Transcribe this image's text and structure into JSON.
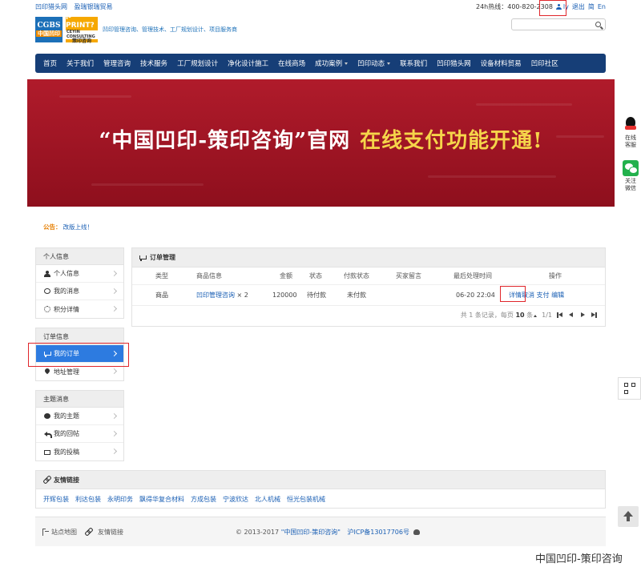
{
  "topbar": {
    "links": [
      "凹印猎头网",
      "盈瑞银瑞贸易"
    ],
    "hotline": "24h热线：400-820-2308",
    "username": "ly",
    "logout": "退出",
    "lang_simplified": "简",
    "lang_english": "En"
  },
  "logo": {
    "cgbs": "CGBS",
    "cgbs_sub": "中国凹印",
    "iprint": "i-PRINT?",
    "iprint_sub": "CEYIN CONSULTING",
    "iprint_cn": "策印咨询",
    "slogan": "凹印管理咨询、管理技术、工厂规划设计、项目服务商"
  },
  "search": {
    "placeholder": ""
  },
  "nav": [
    "首页",
    "关于我们",
    "管理咨询",
    "技术服务",
    "工厂规划设计",
    "净化设计施工",
    "在线商场",
    "成功案例",
    "凹印动态",
    "联系我们",
    "凹印猎头网",
    "设备材料贸易",
    "凹印社区"
  ],
  "nav_has_caret": [
    false,
    false,
    false,
    false,
    false,
    false,
    false,
    true,
    true,
    false,
    false,
    false,
    false
  ],
  "banner": {
    "title_main": "“中国凹印-策印咨询”官网",
    "title_highlight": "在线支付功能开通!",
    "bg_color": "#a0172a",
    "highlight_color": "#f5d54a"
  },
  "side": {
    "qq_label_1": "在线",
    "qq_label_2": "客服",
    "wechat_label_1": "关注",
    "wechat_label_2": "微信"
  },
  "notice": {
    "label": "公告：",
    "text": "改版上线！"
  },
  "sidebar": {
    "personal": {
      "title": "个人信息",
      "items": [
        "个人信息",
        "我的消息",
        "积分详情"
      ]
    },
    "orders": {
      "title": "订单信息",
      "items": [
        "我的订单",
        "地址管理"
      ]
    },
    "topics": {
      "title": "主题消息",
      "items": [
        "我的主题",
        "我的回帖",
        "我的投稿"
      ]
    }
  },
  "orders": {
    "title": "订单管理",
    "columns": [
      "类型",
      "商品信息",
      "金额",
      "状态",
      "付款状态",
      "买家留言",
      "最后处理时间",
      "操作"
    ],
    "rows": [
      {
        "type": "商品",
        "product": "凹印管理咨询",
        "qty": "× 2",
        "amount": "120000",
        "status": "待付款",
        "pay_status": "未付款",
        "message": "",
        "time": "06-20 22:04",
        "actions": [
          "详情",
          "取消",
          "支付",
          "编辑"
        ]
      }
    ],
    "pager": {
      "summary_prefix": "共",
      "total": "1",
      "summary_mid": "条记录，每页",
      "per_page": "10",
      "summary_suffix": "条",
      "page_info": "1/1"
    }
  },
  "links": {
    "title": "友情链接",
    "items": [
      "开辉包装",
      "利达包装",
      "永明印务",
      "飘得华复合材料",
      "方成包装",
      "宁波欣达",
      "北人机械",
      "恒光包装机械"
    ]
  },
  "footer": {
    "sitemap": "站点地图",
    "flinks": "友情链接",
    "copyright": "© 2013-2017",
    "brand": "\"中国凹印-策印咨询\"",
    "icp": "沪ICP备13017706号"
  },
  "watermark": "中国凹印-策印咨询",
  "colors": {
    "nav_bg": "#163e77",
    "accent_blue": "#2d7be0",
    "highlight_red": "#e0262b"
  }
}
